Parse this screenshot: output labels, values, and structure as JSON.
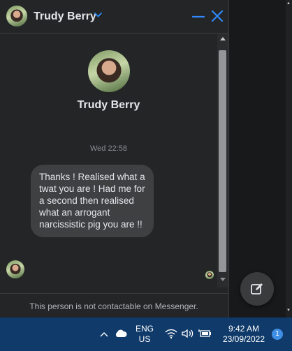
{
  "header": {
    "contact_name": "Trudy Berry"
  },
  "profile": {
    "name": "Trudy Berry"
  },
  "conversation": {
    "timestamp": "Wed 22:58",
    "messages": [
      {
        "sender": "Trudy Berry",
        "text": "Thanks ! Realised what a twat you are ! Had me for a second then realised what an arrogant narcissistic pig you are !!"
      }
    ]
  },
  "footer": {
    "notice": "This person is not contactable on Messenger."
  },
  "taskbar": {
    "language_line1": "ENG",
    "language_line2": "US",
    "time": "9:42 AM",
    "date": "23/09/2022",
    "notification_count": "1"
  },
  "colors": {
    "accent": "#2e89ff",
    "window_bg": "#242526",
    "bubble_bg": "#3e4042",
    "taskbar_bg": "#0f3a69"
  },
  "icons": [
    "chevron-down-icon",
    "minimize-icon",
    "close-icon",
    "compose-icon",
    "chevron-up-icon",
    "cloud-icon",
    "wifi-icon",
    "speaker-icon",
    "battery-icon"
  ]
}
